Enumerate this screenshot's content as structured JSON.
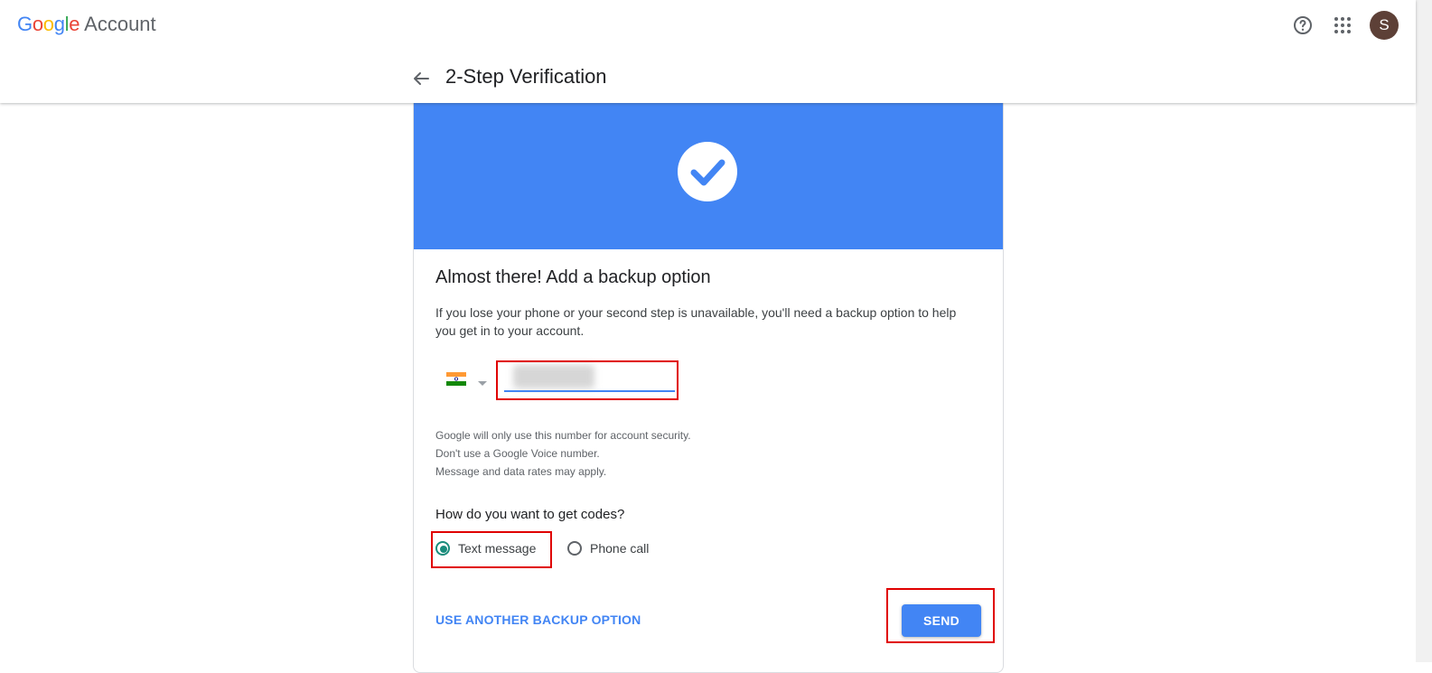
{
  "header": {
    "brand": {
      "google": [
        "G",
        "o",
        "o",
        "g",
        "l",
        "e"
      ],
      "colors": [
        "#4285F4",
        "#EA4335",
        "#FBBC05",
        "#4285F4",
        "#34A853",
        "#EA4335"
      ],
      "account": "Account"
    },
    "help_icon": "help-circle-icon",
    "apps_icon": "apps-grid-icon",
    "avatar_initial": "S",
    "back_icon": "arrow-back-icon",
    "page_title": "2-Step Verification"
  },
  "card": {
    "banner_color": "#4285f4",
    "banner_icon": "check-circle-icon",
    "title": "Almost there! Add a backup option",
    "description": "If you lose your phone or your second step is unavailable, you'll need a backup option to help you get in to your account.",
    "phone": {
      "country_flag": "india-flag-icon",
      "value": ""
    },
    "notes": [
      "Google will only use this number for account security.",
      "Don't use a Google Voice number.",
      "Message and data rates may apply."
    ],
    "codes_question": "How do you want to get codes?",
    "options": [
      {
        "label": "Text message",
        "selected": true
      },
      {
        "label": "Phone call",
        "selected": false
      }
    ],
    "alt_link": "USE ANOTHER BACKUP OPTION",
    "send_label": "SEND",
    "accent_color": "#4285f4",
    "radio_selected_color": "#1a8c7c"
  },
  "annotations": {
    "highlight_color": "#e00000"
  }
}
